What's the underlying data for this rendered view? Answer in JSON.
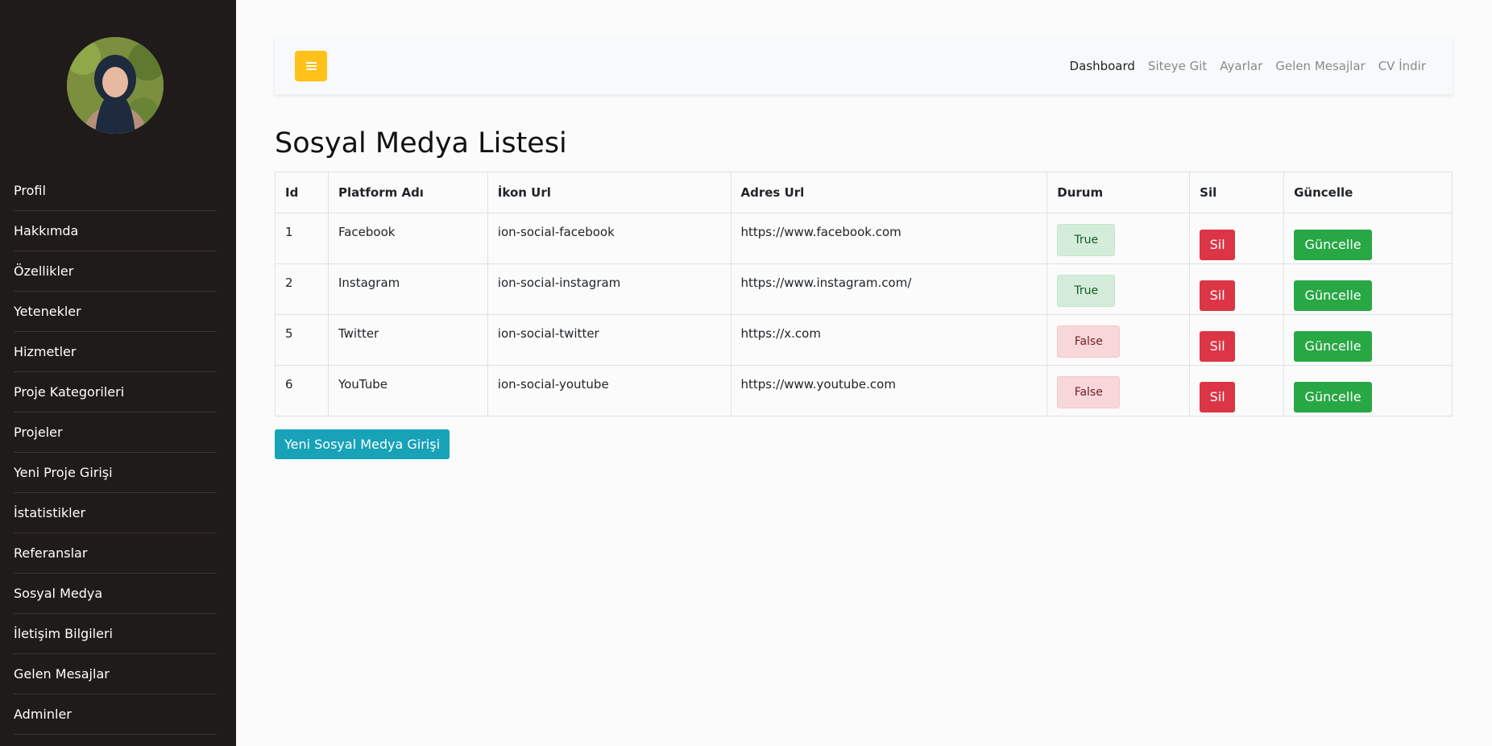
{
  "sidebar": {
    "items": [
      {
        "label": "Profil"
      },
      {
        "label": "Hakkımda"
      },
      {
        "label": "Özellikler"
      },
      {
        "label": "Yetenekler"
      },
      {
        "label": "Hizmetler"
      },
      {
        "label": "Proje Kategorileri"
      },
      {
        "label": "Projeler"
      },
      {
        "label": "Yeni Proje Girişi"
      },
      {
        "label": "İstatistikler"
      },
      {
        "label": "Referanslar"
      },
      {
        "label": "Sosyal Medya"
      },
      {
        "label": "İletişim Bilgileri"
      },
      {
        "label": "Gelen Mesajlar"
      },
      {
        "label": "Adminler"
      }
    ]
  },
  "navbar": {
    "toggle_icon": "bars-icon",
    "toggle_color": "#ffc11a",
    "links": [
      {
        "label": "Dashboard"
      },
      {
        "label": "Siteye Git"
      },
      {
        "label": "Ayarlar"
      },
      {
        "label": "Gelen Mesajlar"
      },
      {
        "label": "CV İndir"
      }
    ]
  },
  "page": {
    "title": "Sosyal Medya Listesi"
  },
  "table": {
    "headers": [
      "Id",
      "Platform Adı",
      "İkon Url",
      "Adres Url",
      "Durum",
      "Sil",
      "Güncelle"
    ],
    "rows": [
      {
        "id": "1",
        "platform": "Facebook",
        "icon": "ion-social-facebook",
        "url": "https://www.facebook.com",
        "status": "True",
        "delete": "Sil",
        "update": "Güncelle"
      },
      {
        "id": "2",
        "platform": "Instagram",
        "icon": "ion-social-instagram",
        "url": "https://www.instagram.com/",
        "status": "True",
        "delete": "Sil",
        "update": "Güncelle"
      },
      {
        "id": "5",
        "platform": "Twitter",
        "icon": "ion-social-twitter",
        "url": "https://x.com",
        "status": "False",
        "delete": "Sil",
        "update": "Güncelle"
      },
      {
        "id": "6",
        "platform": "YouTube",
        "icon": "ion-social-youtube",
        "url": "https://www.youtube.com",
        "status": "False",
        "delete": "Sil",
        "update": "Güncelle"
      }
    ]
  },
  "new_button": {
    "label": "Yeni Sosyal Medya Girişi"
  },
  "colors": {
    "sidebar_bg": "#1f1b1a",
    "delete": "#dc3545",
    "update": "#28a745",
    "new": "#17a2b8",
    "true_badge": "#d4edda",
    "false_badge": "#f8d7da"
  }
}
